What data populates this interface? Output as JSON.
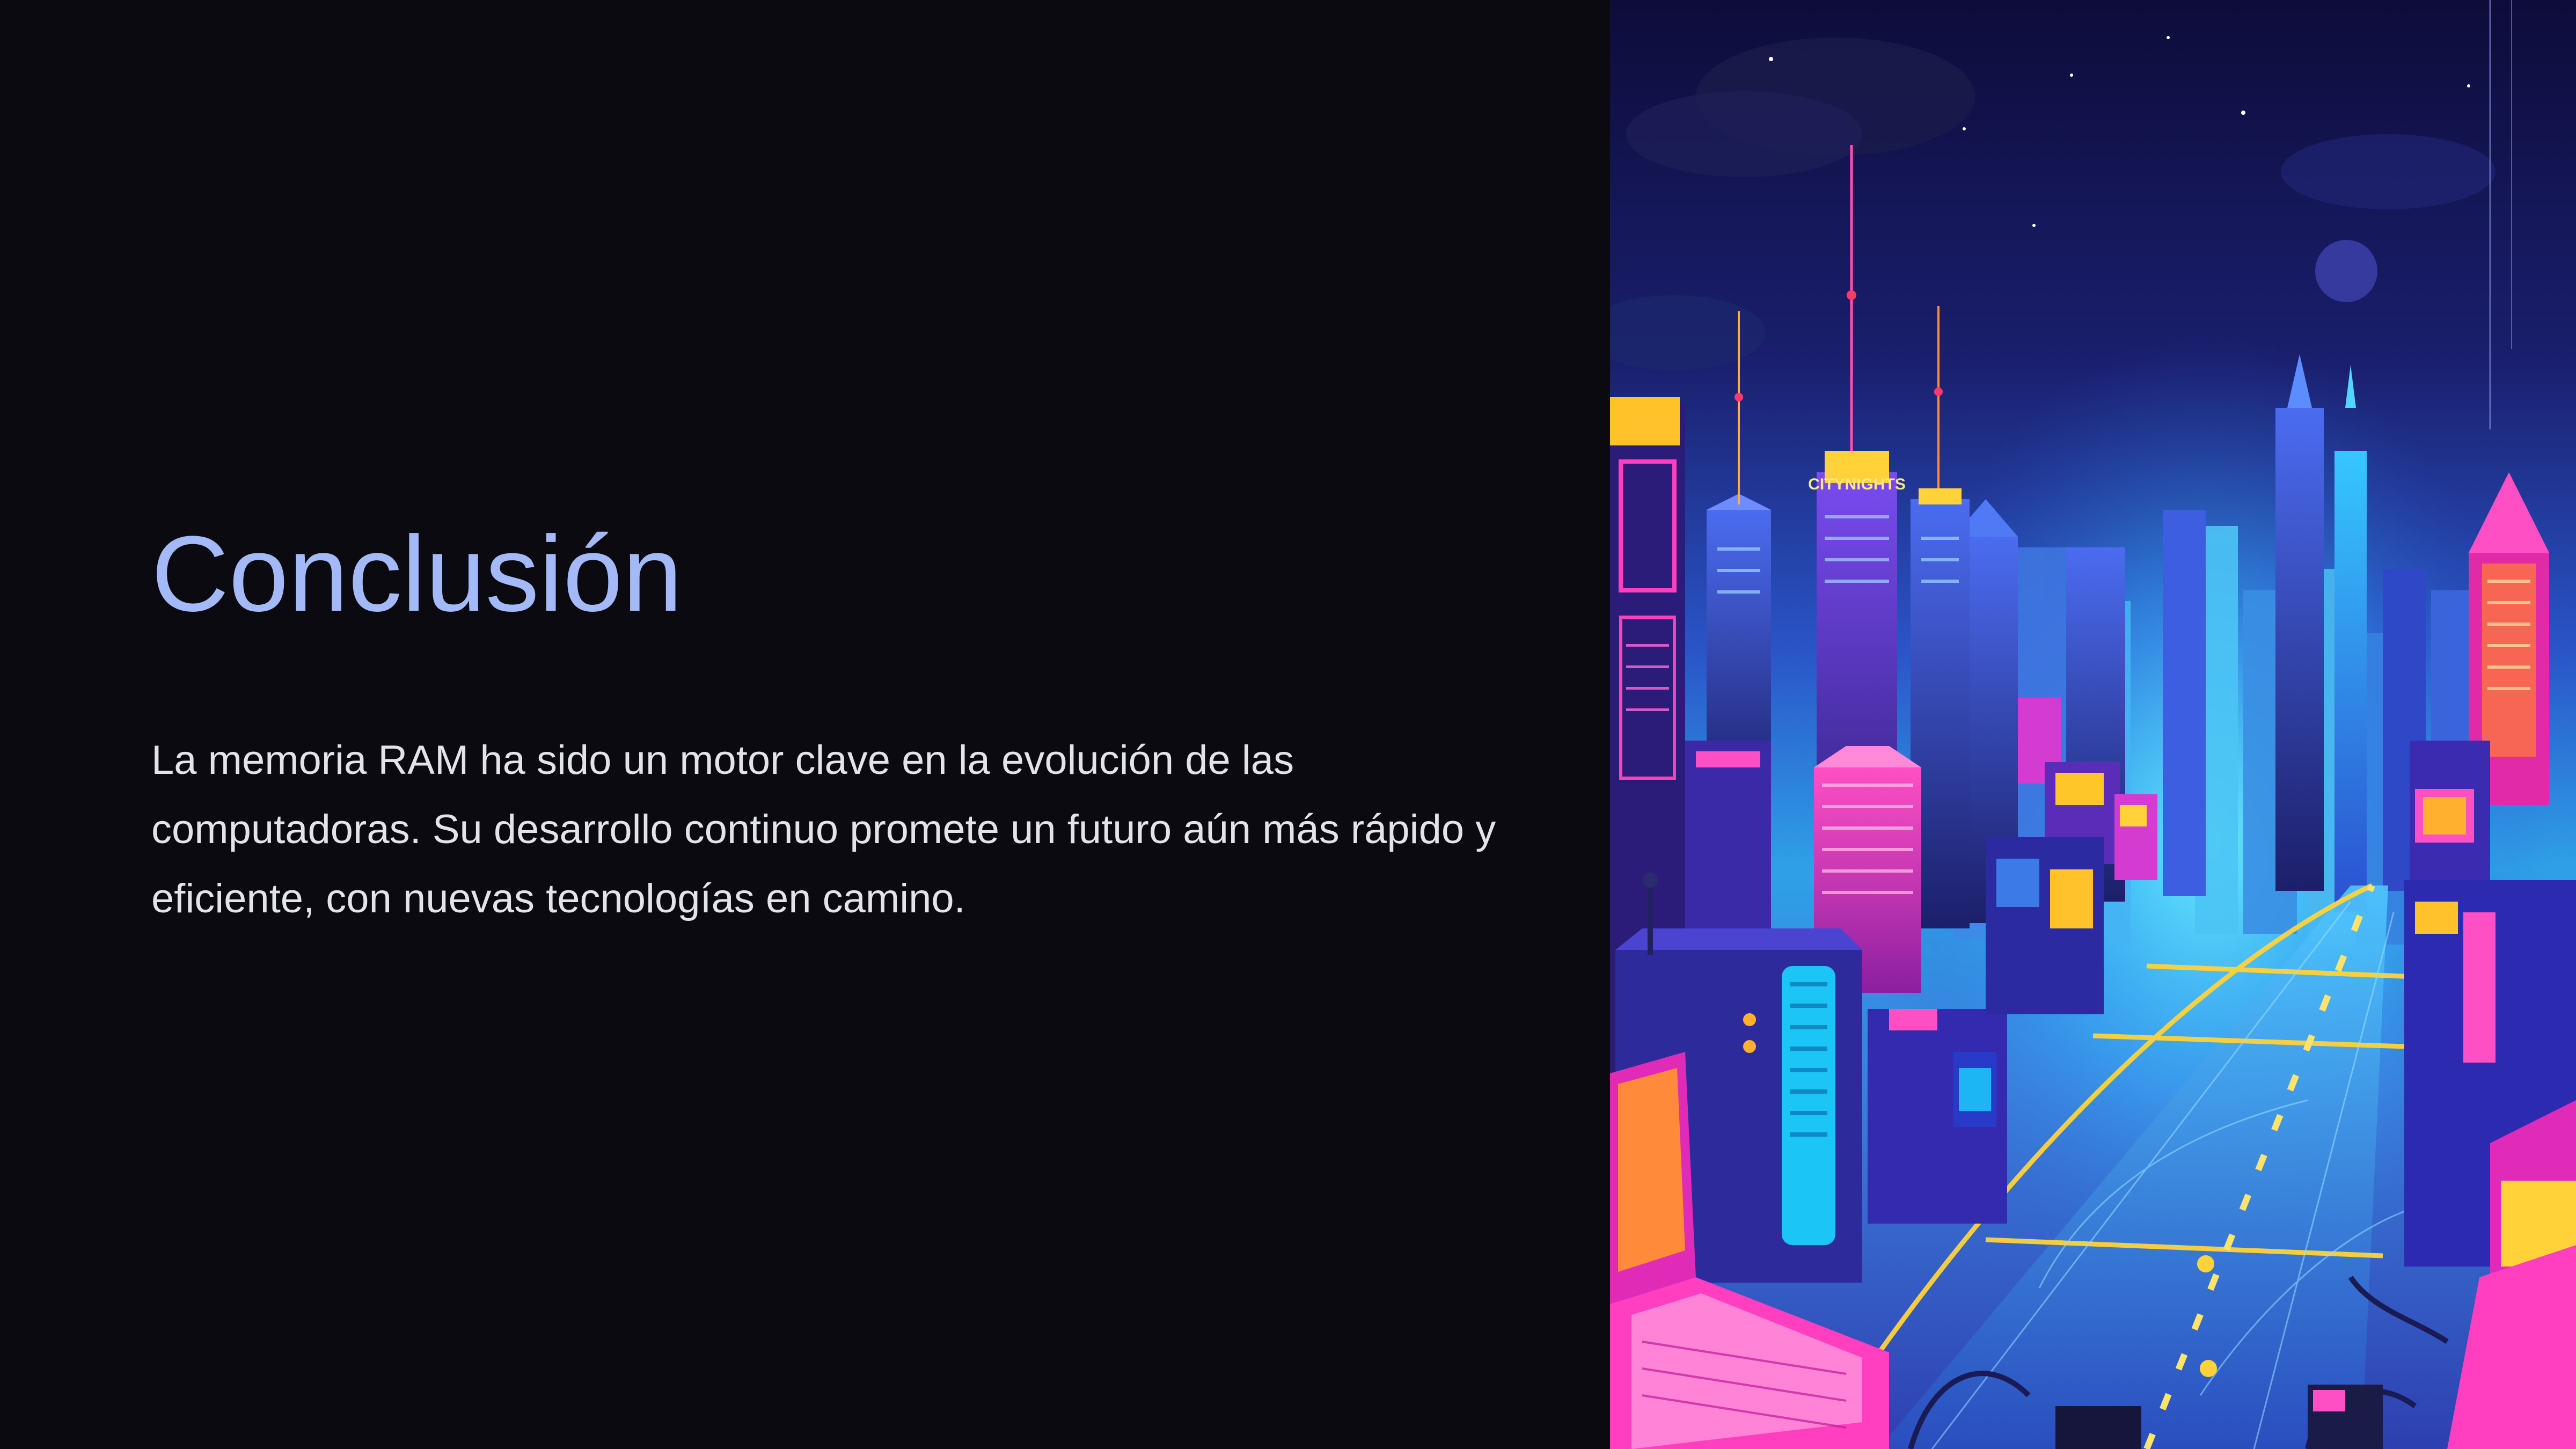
{
  "slide": {
    "title": "Conclusión",
    "body": "La memoria RAM ha sido un motor clave en la evolución de las computadoras. Su desarrollo continuo promete un futuro aún más rápido y eficiente, con nuevas tecnologías en camino."
  },
  "illustration": {
    "icon": "neon-cyberpunk-city-illustration",
    "sign_text": "CITYNIGHTS"
  },
  "colors": {
    "background": "#0a0a10",
    "title": "#a4b9f7",
    "body": "#e3e3ea",
    "neon_pink": "#ff2fb4",
    "neon_cyan": "#38d6ff",
    "neon_yellow": "#ffd23a",
    "sky_blue": "#2e4fc9"
  }
}
